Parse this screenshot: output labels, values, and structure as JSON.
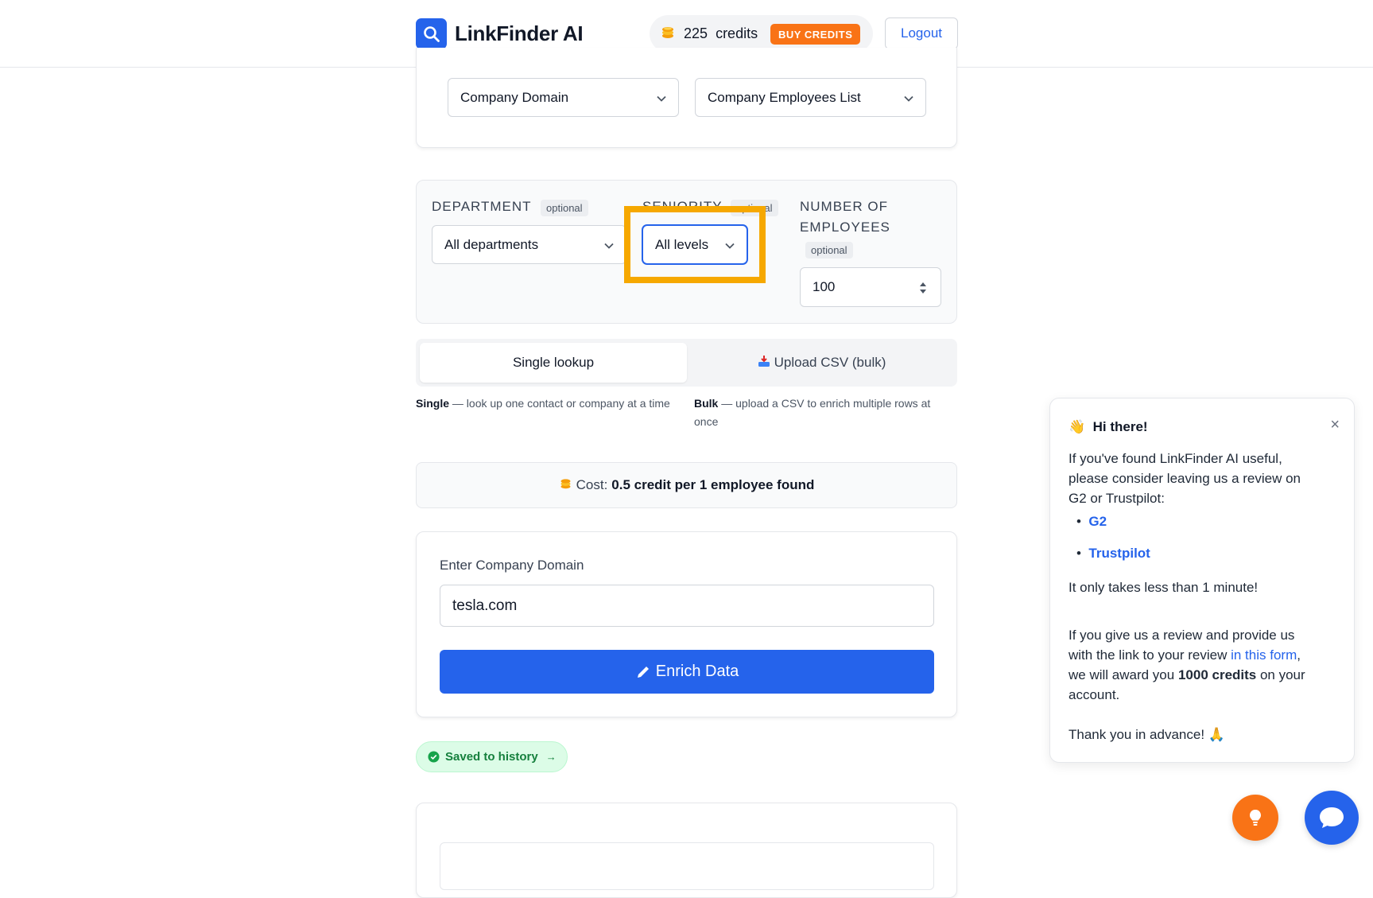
{
  "header": {
    "brand": "LinkFinder AI",
    "credits_count": "225",
    "credits_label": "credits",
    "buy_label": "BUY CREDITS",
    "logout_label": "Logout"
  },
  "source": {
    "input_type": "Company Domain",
    "output_type": "Company Employees List"
  },
  "filters": {
    "department_label": "DEPARTMENT",
    "department_optional": "optional",
    "department_value": "All departments",
    "seniority_label": "SENIORITY",
    "seniority_optional": "optional",
    "seniority_value": "All levels",
    "employees_label_1": "NUMBER OF",
    "employees_label_2": "EMPLOYEES",
    "employees_optional": "optional",
    "employees_value": "100"
  },
  "tabs": {
    "single": "Single lookup",
    "bulk": "Upload CSV (bulk)",
    "single_desc_bold": "Single",
    "single_desc": "— look up one contact or company at a time",
    "bulk_desc_bold": "Bulk",
    "bulk_desc": "— upload a CSV to enrich multiple rows at once"
  },
  "cost": {
    "label": "Cost:",
    "value": "0.5 credit per 1 employee found"
  },
  "form": {
    "domain_label": "Enter Company Domain",
    "domain_value": "tesla.com",
    "enrich_label": "Enrich Data"
  },
  "saved": {
    "label": "Saved to history",
    "arrow": "→"
  },
  "popup": {
    "emoji": "👋",
    "title": "Hi there!",
    "close": "×",
    "line1": "If you've found LinkFinder AI useful,",
    "line2": "please consider leaving us a review on",
    "line3": "G2 or Trustpilot:",
    "link_g2": "G2",
    "link_trustpilot": "Trustpilot",
    "line4": "It only takes less than 1 minute!",
    "line5": "If you give us a review and provide us",
    "line6a": "with the link to your review ",
    "line6_link": "in this form",
    "line6b": ",",
    "line7a": "we will award you ",
    "line7_bold": "1000 credits",
    "line7b": " on your",
    "line8": "account.",
    "line9": "Thank you in advance! 🙏"
  },
  "colors": {
    "primary": "#2563eb",
    "accent": "#f97316",
    "highlight": "#f6a800",
    "success": "#15803d"
  }
}
